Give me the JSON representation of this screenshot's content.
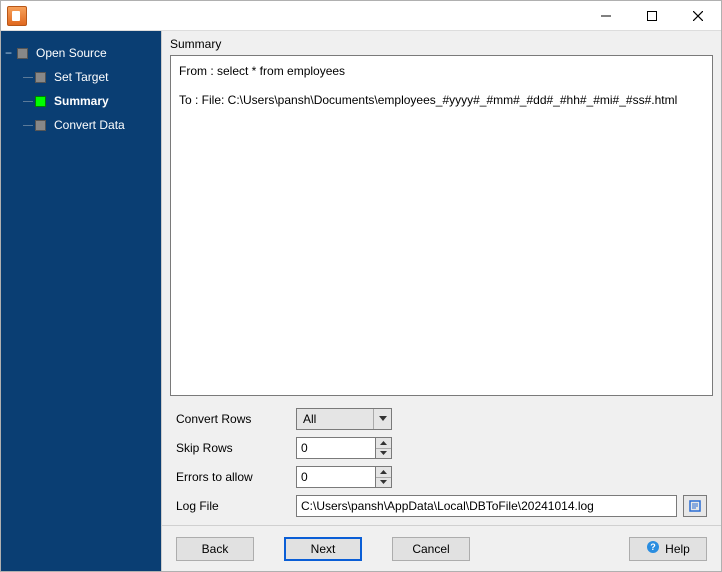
{
  "sidebar": {
    "items": [
      {
        "label": "Open Source"
      },
      {
        "label": "Set Target"
      },
      {
        "label": "Summary"
      },
      {
        "label": "Convert Data"
      }
    ]
  },
  "main": {
    "summary_label": "Summary",
    "summary_from": "From : select * from employees",
    "summary_to": "To : File: C:\\Users\\pansh\\Documents\\employees_#yyyy#_#mm#_#dd#_#hh#_#mi#_#ss#.html"
  },
  "form": {
    "convert_rows_label": "Convert Rows",
    "convert_rows_value": "All",
    "skip_rows_label": "Skip Rows",
    "skip_rows_value": "0",
    "errors_label": "Errors to allow",
    "errors_value": "0",
    "logfile_label": "Log File",
    "logfile_value": "C:\\Users\\pansh\\AppData\\Local\\DBToFile\\20241014.log"
  },
  "buttons": {
    "back": "Back",
    "next": "Next",
    "cancel": "Cancel",
    "help": "Help"
  }
}
